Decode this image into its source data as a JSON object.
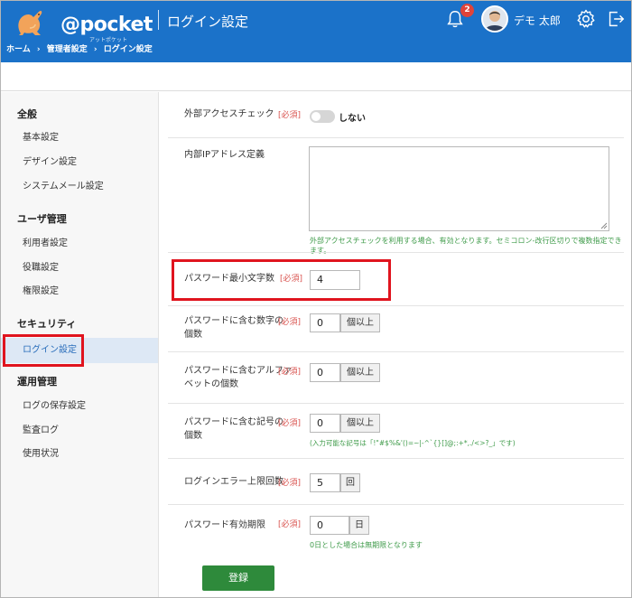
{
  "header": {
    "logo_text": "@pocket",
    "logo_sub": "アットポケット",
    "page_title": "ログイン設定",
    "notification_count": "2",
    "user_name": "デモ 太郎"
  },
  "breadcrumb": [
    "ホーム",
    "›",
    "管理者設定",
    "›",
    "ログイン設定"
  ],
  "sidebar": {
    "sections": [
      {
        "title": "全般",
        "items": [
          "基本設定",
          "デザイン設定",
          "システムメール設定"
        ]
      },
      {
        "title": "ユーザ管理",
        "items": [
          "利用者設定",
          "役職設定",
          "権限設定"
        ]
      },
      {
        "title": "セキュリティ",
        "items": [
          "ログイン設定"
        ]
      },
      {
        "title": "運用管理",
        "items": [
          "ログの保存設定",
          "監査ログ",
          "使用状況"
        ]
      }
    ],
    "active_item": "ログイン設定"
  },
  "form": {
    "required_label": "[必須]",
    "external_access": {
      "label": "外部アクセスチェック",
      "toggle_text": "しない"
    },
    "internal_ip": {
      "label": "内部IPアドレス定義",
      "value": "",
      "hint": "外部アクセスチェックを利用する場合、有効となります。セミコロン-改行区切りで複数指定できます。"
    },
    "pw_min_length": {
      "label": "パスワード最小文字数",
      "value": "4"
    },
    "pw_digits": {
      "label_line1": "パスワードに含む数字の",
      "label_line2": "個数",
      "value": "0",
      "unit": "個以上"
    },
    "pw_alpha": {
      "label_line1": "パスワードに含むアルファ",
      "label_line2": "ベットの個数",
      "value": "0",
      "unit": "個以上"
    },
    "pw_symbols": {
      "label_line1": "パスワードに含む記号の",
      "label_line2": "個数",
      "value": "0",
      "unit": "個以上",
      "hint": "(入力可能な記号は「!\"#$%&'()=~|-^`{}[]@;:+*,./<>?_」です)"
    },
    "login_error_limit": {
      "label": "ログインエラー上限回数",
      "value": "5",
      "unit": "回"
    },
    "pw_expiry": {
      "label": "パスワード有効期限",
      "value": "0",
      "unit": "日",
      "hint": "0日とした場合は無期限となります"
    },
    "submit_label": "登録"
  },
  "colors": {
    "header_bg": "#1b72c9",
    "required": "#d9534f",
    "hint": "#3f9b4a",
    "submit": "#2e8a3b",
    "highlight": "#e0141e"
  }
}
